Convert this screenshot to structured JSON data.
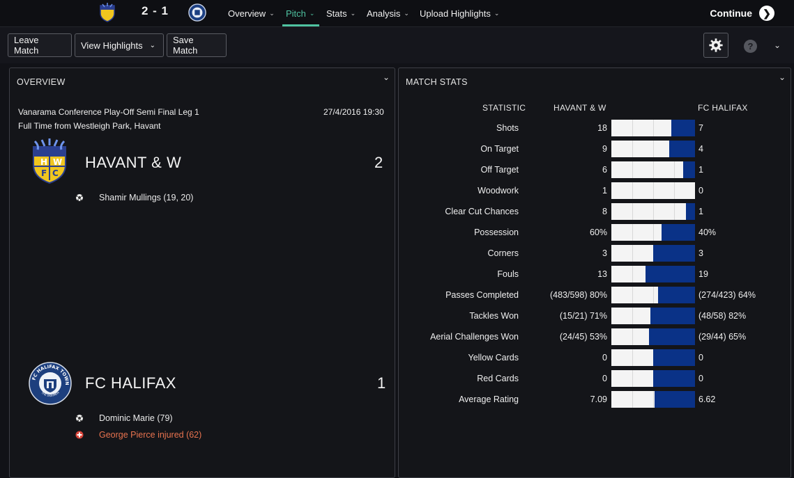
{
  "header": {
    "score": "2 - 1",
    "nav": [
      {
        "label": "Overview"
      },
      {
        "label": "Pitch"
      },
      {
        "label": "Stats"
      },
      {
        "label": "Analysis"
      },
      {
        "label": "Upload Highlights"
      }
    ],
    "active_tab": "Pitch",
    "continue_label": "Continue",
    "accent_color": "#4fc3a1"
  },
  "toolbar": {
    "leave_label": "Leave Match",
    "highlights_label": "View Highlights",
    "save_label": "Save Match",
    "help_glyph": "?"
  },
  "overview": {
    "title": "OVERVIEW",
    "competition": "Vanarama Conference Play-Off Semi Final Leg 1",
    "datetime": "27/4/2016 19:30",
    "venue": "Full Time from Westleigh Park, Havant",
    "home": {
      "name": "HAVANT & W",
      "goals": "2",
      "crest_letters": [
        "H",
        "W",
        "F",
        "C"
      ],
      "events": [
        {
          "type": "goal",
          "text": "Shamir Mullings (19, 20)"
        }
      ]
    },
    "away": {
      "name": "FC HALIFAX",
      "goals": "1",
      "crest_text": "FC HALIFAX TOWN",
      "crest_motto": "THE SHAYMEN",
      "events": [
        {
          "type": "goal",
          "text": "Dominic Marie (79)"
        },
        {
          "type": "injury",
          "text": "George Pierce injured (62)"
        }
      ]
    }
  },
  "stats": {
    "title": "MATCH STATS",
    "col_stat": "STATISTIC",
    "col_home": "HAVANT & W",
    "col_away": "FC HALIFAX",
    "home_color": "#f4f4f4",
    "away_color": "#0a3287",
    "rows": [
      {
        "label": "Shots",
        "home": "18",
        "away": "7",
        "home_share": 0.72
      },
      {
        "label": "On Target",
        "home": "9",
        "away": "4",
        "home_share": 0.69
      },
      {
        "label": "Off Target",
        "home": "6",
        "away": "1",
        "home_share": 0.86
      },
      {
        "label": "Woodwork",
        "home": "1",
        "away": "0",
        "home_share": 1.0
      },
      {
        "label": "Clear Cut Chances",
        "home": "8",
        "away": "1",
        "home_share": 0.89
      },
      {
        "label": "Possession",
        "home": "60%",
        "away": "40%",
        "home_share": 0.6
      },
      {
        "label": "Corners",
        "home": "3",
        "away": "3",
        "home_share": 0.5
      },
      {
        "label": "Fouls",
        "home": "13",
        "away": "19",
        "home_share": 0.41
      },
      {
        "label": "Passes Completed",
        "home": "(483/598) 80%",
        "away": "(274/423) 64%",
        "home_share": 0.56
      },
      {
        "label": "Tackles Won",
        "home": "(15/21) 71%",
        "away": "(48/58) 82%",
        "home_share": 0.47
      },
      {
        "label": "Aerial Challenges Won",
        "home": "(24/45) 53%",
        "away": "(29/44) 65%",
        "home_share": 0.45
      },
      {
        "label": "Yellow Cards",
        "home": "0",
        "away": "0",
        "home_share": 0.5
      },
      {
        "label": "Red Cards",
        "home": "0",
        "away": "0",
        "home_share": 0.5
      },
      {
        "label": "Average Rating",
        "home": "7.09",
        "away": "6.62",
        "home_share": 0.52
      }
    ]
  }
}
